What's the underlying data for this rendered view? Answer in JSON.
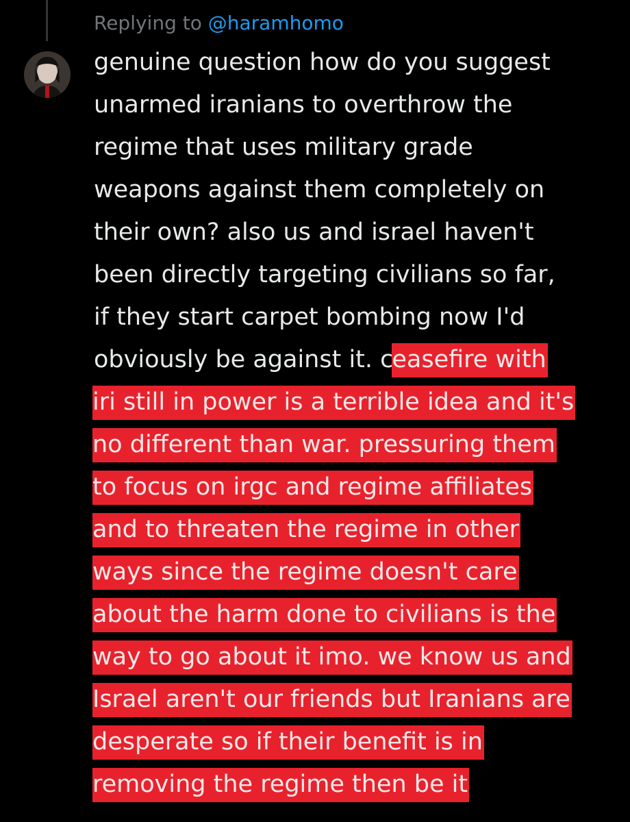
{
  "reply": {
    "prefix": "Replying to ",
    "handle": "@haramhomo"
  },
  "tweet": {
    "lines": [
      "genuine question how do you suggest",
      "unarmed iranians to overthrow the",
      "regime that uses military grade",
      "weapons against them completely on",
      "their own? also us and israel haven't",
      "been directly targeting civilians so far,",
      "if they start carpet bombing now I'd",
      "obviously be against it. c"
    ],
    "highlighted_lines": [
      "easefire with",
      "iri still in power is a terrible idea and it's",
      "no different than war. pressuring them",
      "to focus on irgc and regime affiliates",
      "and to threaten the regime in other",
      "ways since the regime doesn't care",
      "about the harm done to civilians is the",
      "way to go about it imo. we know us and",
      "Israel aren't our friends but Iranians are",
      "desperate so if their benefit is in",
      "removing the regime then be it"
    ]
  },
  "colors": {
    "background": "#000000",
    "text": "#e7e9ea",
    "muted": "#71767b",
    "link": "#1d9bf0",
    "highlight": "#e8222d"
  },
  "icons": {
    "avatar": "user-avatar"
  }
}
